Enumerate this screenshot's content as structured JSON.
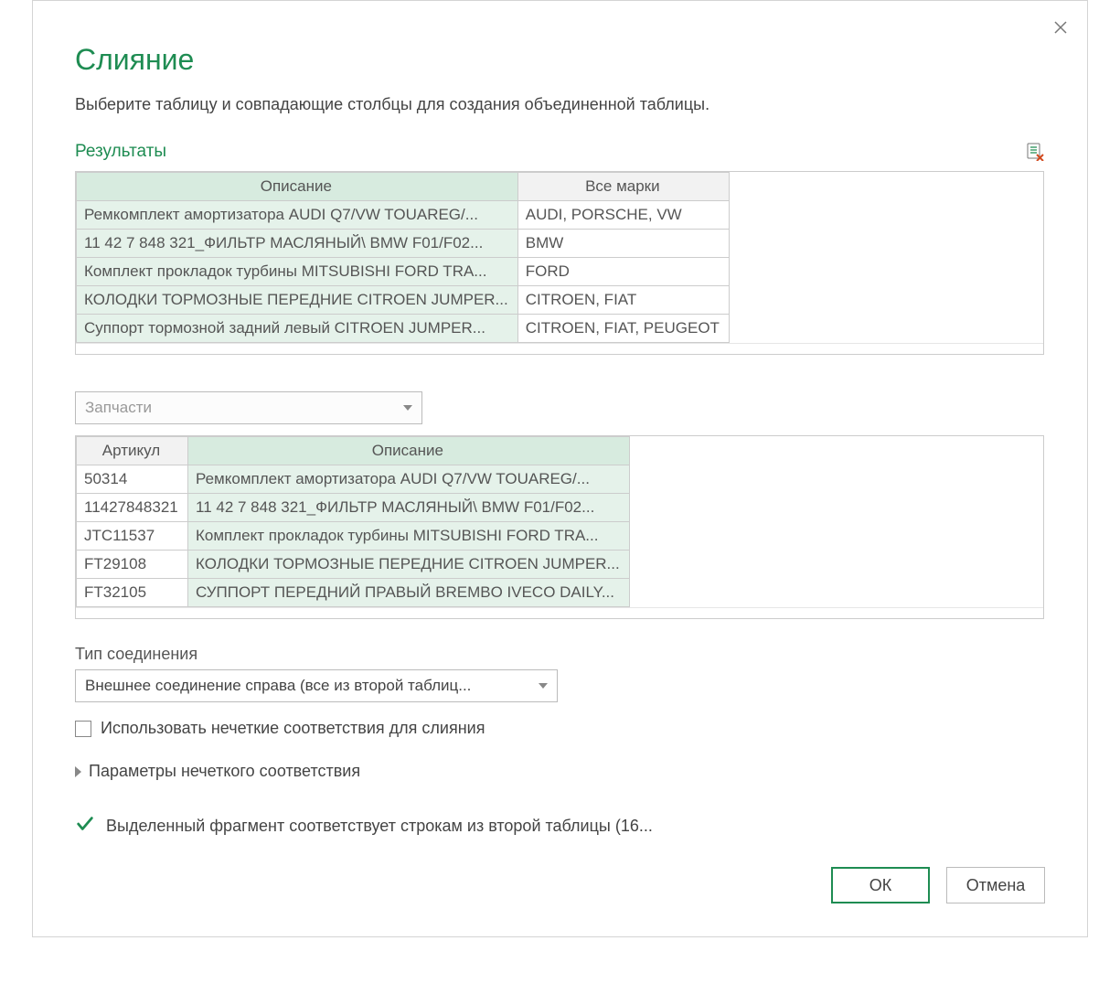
{
  "dialog": {
    "title": "Слияние",
    "subtitle": "Выберите таблицу и совпадающие столбцы для создания объединенной таблицы."
  },
  "first_query": {
    "label": "Результаты",
    "columns": [
      "Описание",
      "Все марки"
    ],
    "rows": [
      {
        "c0": "Ремкомплект амортизатора AUDI Q7/VW TOUAREG/...",
        "c1": "AUDI, PORSCHE, VW"
      },
      {
        "c0": "11 42 7 848 321_ФИЛЬТР МАСЛЯНЫЙ\\ BMW F01/F02...",
        "c1": "BMW"
      },
      {
        "c0": "Комплект прокладок турбины MITSUBISHI FORD TRA...",
        "c1": "FORD"
      },
      {
        "c0": "КОЛОДКИ ТОРМОЗНЫЕ ПЕРЕДНИЕ CITROEN JUMPER...",
        "c1": "CITROEN, FIAT"
      },
      {
        "c0": "Суппорт тормозной задний левый CITROEN JUMPER...",
        "c1": "CITROEN, FIAT, PEUGEOT"
      }
    ]
  },
  "second_query": {
    "selected": "Запчасти",
    "columns": [
      "Артикул",
      "Описание"
    ],
    "rows": [
      {
        "c0": "50314",
        "c1": "Ремкомплект амортизатора AUDI Q7/VW TOUAREG/..."
      },
      {
        "c0": "11427848321",
        "c1": "11 42 7 848 321_ФИЛЬТР МАСЛЯНЫЙ\\ BMW F01/F02..."
      },
      {
        "c0": "JTC11537",
        "c1": "Комплект прокладок турбины MITSUBISHI FORD TRA..."
      },
      {
        "c0": "FT29108",
        "c1": "КОЛОДКИ ТОРМОЗНЫЕ ПЕРЕДНИЕ CITROEN JUMPER..."
      },
      {
        "c0": "FT32105",
        "c1": "СУППОРТ ПЕРЕДНИЙ ПРАВЫЙ BREMBO IVECO DAILY..."
      }
    ]
  },
  "join": {
    "label": "Тип соединения",
    "selected": "Внешнее соединение справа (все из второй таблиц..."
  },
  "fuzzy": {
    "checkbox_label": "Использовать нечеткие соответствия для слияния",
    "options_label": "Параметры нечеткого соответствия"
  },
  "status": {
    "text": "Выделенный фрагмент соответствует строкам из второй таблицы (16..."
  },
  "buttons": {
    "ok": "ОК",
    "cancel": "Отмена"
  }
}
